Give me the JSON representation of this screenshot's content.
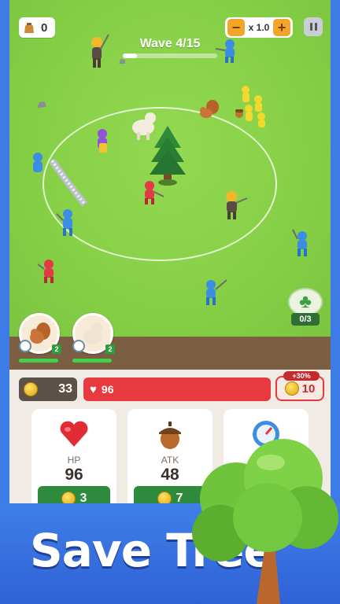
{
  "hud": {
    "inventory_count": "0",
    "wave_label": "Wave 4/15",
    "wave_progress": 0.15,
    "speed_label": "x 1.0",
    "speed_minus": "−",
    "speed_plus": "+"
  },
  "field": {
    "clover_count": "0/3"
  },
  "pets": [
    {
      "name": "squirrel",
      "level": "2",
      "hp_fraction": 1.0
    },
    {
      "name": "alpaca",
      "level": "2",
      "hp_fraction": 1.0
    }
  ],
  "stats": {
    "gold": "33",
    "tree_hp": "96",
    "heal_bonus": "+30%",
    "heal_cost": "10"
  },
  "upgrades": [
    {
      "label": "HP",
      "value": "96",
      "cost": "3",
      "icon": "heart-icon"
    },
    {
      "label": "ATK",
      "value": "48",
      "cost": "7",
      "icon": "acorn-icon"
    },
    {
      "label": "",
      "value": "",
      "cost": "",
      "icon": "gauge-icon"
    }
  ],
  "promo": {
    "title": "Save Tree"
  },
  "colors": {
    "grass": "#85cf46",
    "hp_red": "#e8393e",
    "buy_green": "#2e8a3c",
    "promo_blue": "#3d7be6"
  }
}
